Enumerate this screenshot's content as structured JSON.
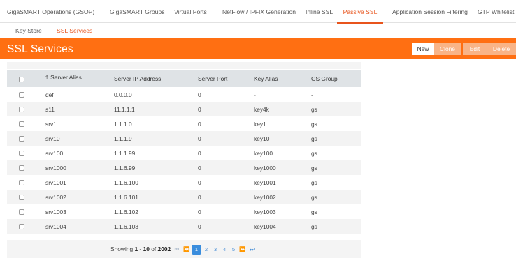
{
  "top_tabs": [
    {
      "label": "GigaSMART Operations (GSOP)",
      "active": false
    },
    {
      "label": "GigaSMART Groups",
      "active": false
    },
    {
      "label": "Virtual Ports",
      "active": false
    },
    {
      "label": "NetFlow / IPFIX Generation",
      "active": false
    },
    {
      "label": "Inline SSL",
      "active": false
    },
    {
      "label": "Passive SSL",
      "active": true
    },
    {
      "label": "Application Session Filtering",
      "active": false
    },
    {
      "label": "GTP Whitelist",
      "active": false
    }
  ],
  "sub_tabs": [
    {
      "label": "Key Store",
      "active": false
    },
    {
      "label": "SSL Services",
      "active": true
    }
  ],
  "header": {
    "title": "SSL Services",
    "buttons": {
      "new": "New",
      "clone": "Clone",
      "edit": "Edit",
      "delete": "Delete"
    }
  },
  "table": {
    "columns": [
      "Server Alias",
      "Server IP Address",
      "Server Port",
      "Key Alias",
      "GS Group"
    ],
    "sort_column": "Server Alias",
    "sort_direction": "ascending",
    "rows": [
      [
        "def",
        "0.0.0.0",
        "0",
        "-",
        "-"
      ],
      [
        "s11",
        "11.1.1.1",
        "0",
        "key4k",
        "gs"
      ],
      [
        "srv1",
        "1.1.1.0",
        "0",
        "key1",
        "gs"
      ],
      [
        "srv10",
        "1.1.1.9",
        "0",
        "key10",
        "gs"
      ],
      [
        "srv100",
        "1.1.1.99",
        "0",
        "key100",
        "gs"
      ],
      [
        "srv1000",
        "1.1.6.99",
        "0",
        "key1000",
        "gs"
      ],
      [
        "srv1001",
        "1.1.6.100",
        "0",
        "key1001",
        "gs"
      ],
      [
        "srv1002",
        "1.1.6.101",
        "0",
        "key1002",
        "gs"
      ],
      [
        "srv1003",
        "1.1.6.102",
        "0",
        "key1003",
        "gs"
      ],
      [
        "srv1004",
        "1.1.6.103",
        "0",
        "key1004",
        "gs"
      ]
    ]
  },
  "pager": {
    "showing_prefix": "Showing",
    "range": "1 - 10",
    "of_label": "of",
    "total": "2002",
    "first_icon": "⏮",
    "prev_icon": "⏪",
    "next_icon": "⏩",
    "last_icon": "⏭",
    "pages": [
      "1",
      "2",
      "3",
      "4",
      "5"
    ],
    "current_page": "1"
  },
  "colors": {
    "accent": "#ff6f12",
    "active_tab": "#e8541c",
    "pager_current": "#3a8ddd"
  }
}
